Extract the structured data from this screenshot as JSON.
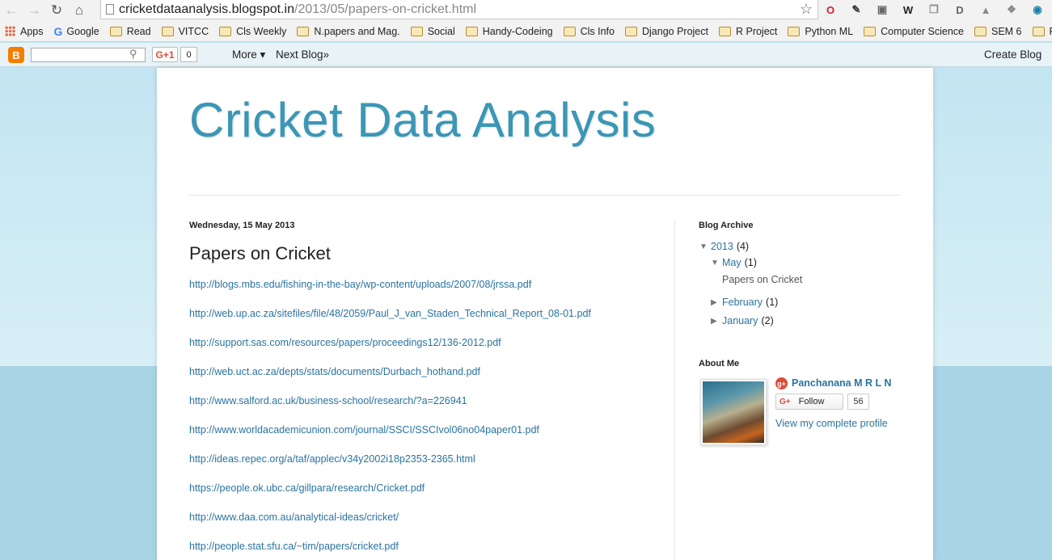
{
  "browser": {
    "url_host": "cricketdataanalysis.blogspot.in",
    "url_path": "/2013/05/papers-on-cricket.html",
    "extensions": [
      {
        "name": "opera-icon",
        "glyph": "O",
        "color": "#d2202f"
      },
      {
        "name": "puzzle-icon",
        "glyph": "✎",
        "color": "#333"
      },
      {
        "name": "extension-badge-icon",
        "glyph": "▣",
        "color": "#666"
      },
      {
        "name": "wikipedia-icon",
        "glyph": "W",
        "color": "#222"
      },
      {
        "name": "copy-icon",
        "glyph": "❐",
        "color": "#888"
      },
      {
        "name": "d-icon",
        "glyph": "D",
        "color": "#666"
      },
      {
        "name": "drive-icon",
        "glyph": "▲",
        "color": "#888"
      },
      {
        "name": "dropbox-icon",
        "glyph": "❖",
        "color": "#888"
      },
      {
        "name": "circle-icon",
        "glyph": "◉",
        "color": "#1a7fa8"
      }
    ]
  },
  "bookmarks": [
    {
      "label": "Apps",
      "type": "apps"
    },
    {
      "label": "Google",
      "type": "google"
    },
    {
      "label": "Read",
      "type": "folder"
    },
    {
      "label": "VITCC",
      "type": "folder"
    },
    {
      "label": "Cls Weekly",
      "type": "folder"
    },
    {
      "label": "N.papers and Mag.",
      "type": "folder"
    },
    {
      "label": "Social",
      "type": "folder"
    },
    {
      "label": "Handy-Codeing",
      "type": "folder"
    },
    {
      "label": "Cls Info",
      "type": "folder"
    },
    {
      "label": "Django Project",
      "type": "folder"
    },
    {
      "label": "R Project",
      "type": "folder"
    },
    {
      "label": "Python ML",
      "type": "folder"
    },
    {
      "label": "Computer Science",
      "type": "folder"
    },
    {
      "label": "SEM 6",
      "type": "folder"
    },
    {
      "label": "Place",
      "type": "folder"
    }
  ],
  "navbar": {
    "gplus_label": "G+1",
    "gplus_count": "0",
    "more_label": "More ▾",
    "next_blog_label": "Next Blog»",
    "create_blog_label": "Create Blog"
  },
  "blog": {
    "title": "Cricket Data Analysis"
  },
  "post": {
    "date": "Wednesday, 15 May 2013",
    "title": "Papers on Cricket",
    "links": [
      "http://blogs.mbs.edu/fishing-in-the-bay/wp-content/uploads/2007/08/jrssa.pdf",
      "http://web.up.ac.za/sitefiles/file/48/2059/Paul_J_van_Staden_Technical_Report_08-01.pdf",
      "http://support.sas.com/resources/papers/proceedings12/136-2012.pdf",
      "http://web.uct.ac.za/depts/stats/documents/Durbach_hothand.pdf",
      "http://www.salford.ac.uk/business-school/research/?a=226941",
      "http://www.worldacademicunion.com/journal/SSCI/SSCIvol06no04paper01.pdf",
      "http://ideas.repec.org/a/taf/applec/v34y2002i18p2353-2365.html",
      "https://people.ok.ubc.ca/gillpara/research/Cricket.pdf",
      "http://www.daa.com.au/analytical-ideas/cricket/",
      "http://people.stat.sfu.ca/~tim/papers/cricket.pdf"
    ]
  },
  "sidebar": {
    "archive_heading": "Blog Archive",
    "year": {
      "label": "2013",
      "count": "(4)"
    },
    "may": {
      "label": "May",
      "count": "(1)"
    },
    "may_post": "Papers on Cricket",
    "february": {
      "label": "February",
      "count": "(1)"
    },
    "january": {
      "label": "January",
      "count": "(2)"
    },
    "about_heading": "About Me",
    "profile_name": "Panchanana M R L N",
    "follow_label": "Follow",
    "follow_count": "56",
    "profile_link": "View my complete profile"
  }
}
